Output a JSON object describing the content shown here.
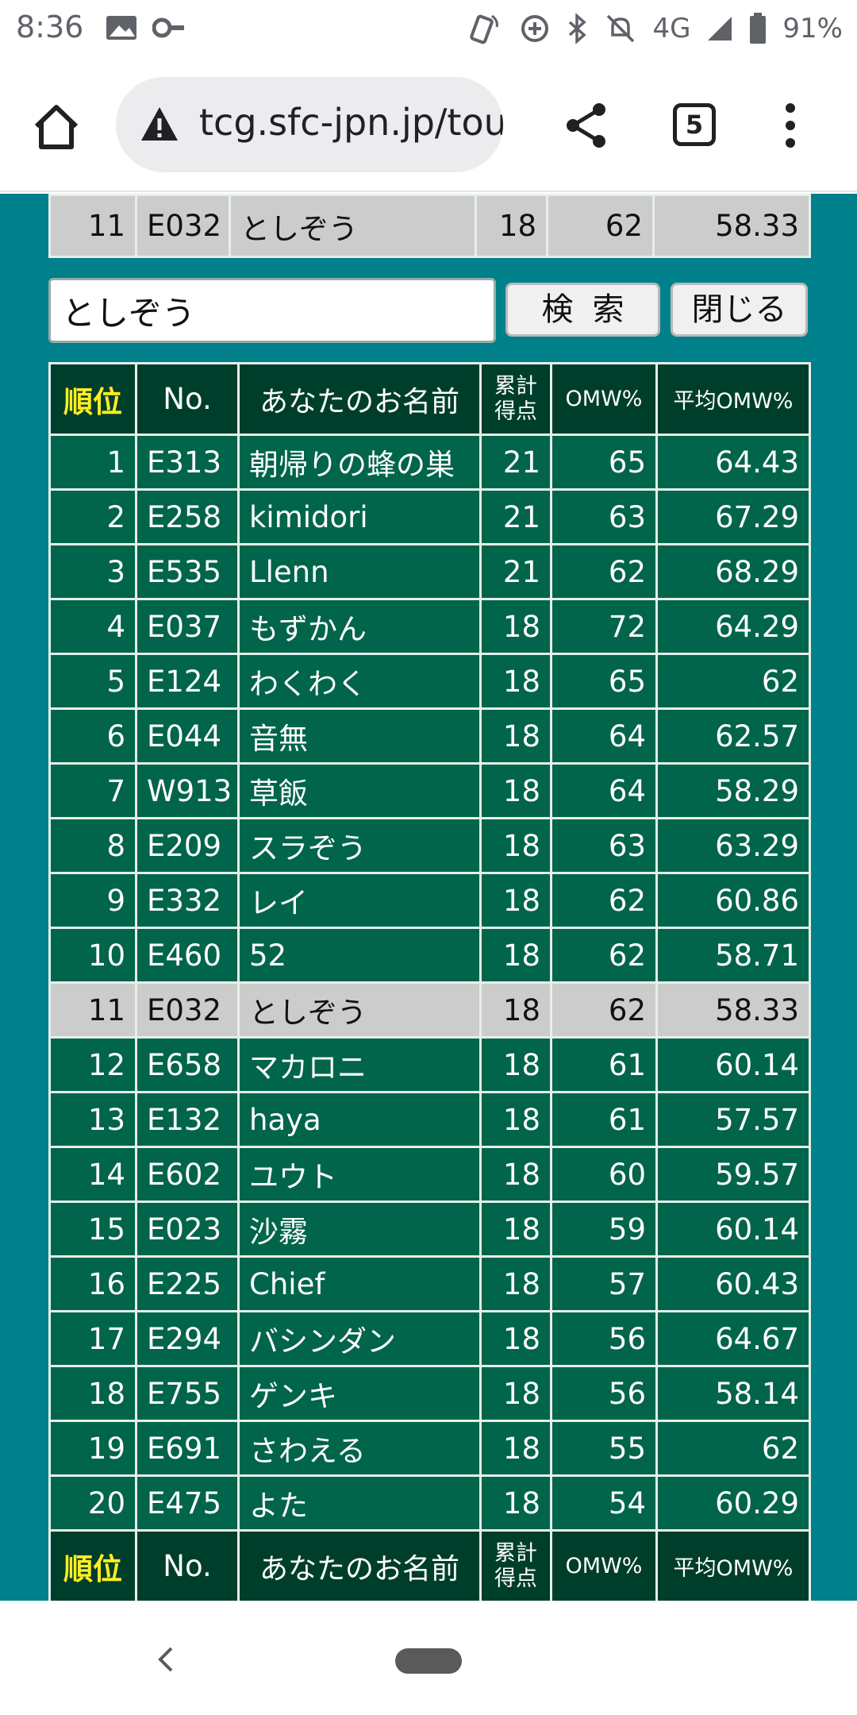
{
  "status_bar": {
    "time": "8:36",
    "network": "4G",
    "battery": "91%",
    "icons": [
      "gallery-icon",
      "key-icon",
      "phone-vibrate-icon",
      "data-saver-icon",
      "bluetooth-icon",
      "mute-icon",
      "signal-icon",
      "battery-icon"
    ]
  },
  "browser": {
    "url": "tcg.sfc-jpn.jp/tou",
    "tab_count": "5"
  },
  "search": {
    "value": "としぞう",
    "search_label": "検索",
    "close_label": "閉じる"
  },
  "result_row": {
    "rank": "11",
    "no": "E032",
    "name": "としぞう",
    "points": "18",
    "omw": "62",
    "avg_omw": "58.33"
  },
  "table": {
    "headers": {
      "rank": "順位",
      "no": "No.",
      "name": "あなたのお名前",
      "points_line1": "累計",
      "points_line2": "得点",
      "omw": "OMW%",
      "avg_omw": "平均OMW%"
    },
    "highlight_rank": "11",
    "rows": [
      {
        "rank": "1",
        "no": "E313",
        "name": "朝帰りの蜂の巣",
        "points": "21",
        "omw": "65",
        "avg_omw": "64.43"
      },
      {
        "rank": "2",
        "no": "E258",
        "name": "kimidori",
        "points": "21",
        "omw": "63",
        "avg_omw": "67.29"
      },
      {
        "rank": "3",
        "no": "E535",
        "name": "Llenn",
        "points": "21",
        "omw": "62",
        "avg_omw": "68.29"
      },
      {
        "rank": "4",
        "no": "E037",
        "name": "もずかん",
        "points": "18",
        "omw": "72",
        "avg_omw": "64.29"
      },
      {
        "rank": "5",
        "no": "E124",
        "name": "わくわく",
        "points": "18",
        "omw": "65",
        "avg_omw": "62"
      },
      {
        "rank": "6",
        "no": "E044",
        "name": "音無",
        "points": "18",
        "omw": "64",
        "avg_omw": "62.57"
      },
      {
        "rank": "7",
        "no": "W913",
        "name": "草飯",
        "points": "18",
        "omw": "64",
        "avg_omw": "58.29"
      },
      {
        "rank": "8",
        "no": "E209",
        "name": "スラぞう",
        "points": "18",
        "omw": "63",
        "avg_omw": "63.29"
      },
      {
        "rank": "9",
        "no": "E332",
        "name": "レイ",
        "points": "18",
        "omw": "62",
        "avg_omw": "60.86"
      },
      {
        "rank": "10",
        "no": "E460",
        "name": "52",
        "points": "18",
        "omw": "62",
        "avg_omw": "58.71"
      },
      {
        "rank": "11",
        "no": "E032",
        "name": "としぞう",
        "points": "18",
        "omw": "62",
        "avg_omw": "58.33"
      },
      {
        "rank": "12",
        "no": "E658",
        "name": "マカロニ",
        "points": "18",
        "omw": "61",
        "avg_omw": "60.14"
      },
      {
        "rank": "13",
        "no": "E132",
        "name": "haya",
        "points": "18",
        "omw": "61",
        "avg_omw": "57.57"
      },
      {
        "rank": "14",
        "no": "E602",
        "name": "ユウト",
        "points": "18",
        "omw": "60",
        "avg_omw": "59.57"
      },
      {
        "rank": "15",
        "no": "E023",
        "name": "沙霧",
        "points": "18",
        "omw": "59",
        "avg_omw": "60.14"
      },
      {
        "rank": "16",
        "no": "E225",
        "name": "Chief",
        "points": "18",
        "omw": "57",
        "avg_omw": "60.43"
      },
      {
        "rank": "17",
        "no": "E294",
        "name": "バシンダン",
        "points": "18",
        "omw": "56",
        "avg_omw": "64.67"
      },
      {
        "rank": "18",
        "no": "E755",
        "name": "ゲンキ",
        "points": "18",
        "omw": "56",
        "avg_omw": "58.14"
      },
      {
        "rank": "19",
        "no": "E691",
        "name": "さわえる",
        "points": "18",
        "omw": "55",
        "avg_omw": "62"
      },
      {
        "rank": "20",
        "no": "E475",
        "name": "よた",
        "points": "18",
        "omw": "54",
        "avg_omw": "60.29"
      }
    ]
  }
}
